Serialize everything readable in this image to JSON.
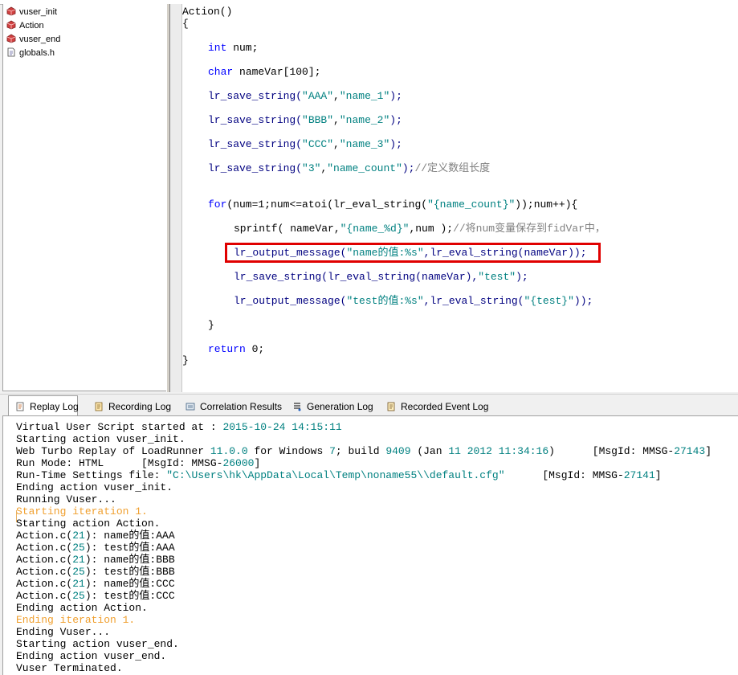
{
  "tree": {
    "items": [
      {
        "label": "vuser_init",
        "icon": "action-script-icon"
      },
      {
        "label": "Action",
        "icon": "action-script-icon"
      },
      {
        "label": "vuser_end",
        "icon": "action-script-icon"
      },
      {
        "label": "globals.h",
        "icon": "header-file-icon"
      }
    ]
  },
  "code": {
    "l1": "Action()",
    "l2": "{",
    "int_kw": "int",
    "int_rest": " num;",
    "char_kw": "char",
    "char_rest": " nameVar[",
    "char_num": "100",
    "char_end": "];",
    "s1_fn": "lr_save_string(",
    "s1_a": "\"AAA\"",
    "s1_b": ",",
    "s1_c": "\"name_1\"",
    "s1_d": ");",
    "s2_fn": "lr_save_string(",
    "s2_a": "\"BBB\"",
    "s2_b": ",",
    "s2_c": "\"name_2\"",
    "s2_d": ");",
    "s3_fn": "lr_save_string(",
    "s3_a": "\"CCC\"",
    "s3_b": ",",
    "s3_c": "\"name_3\"",
    "s3_d": ");",
    "s4_fn": "lr_save_string(",
    "s4_a": "\"3\"",
    "s4_b": ",",
    "s4_c": "\"name_count\"",
    "s4_d": ");",
    "s4_cmt": "//定义数组长度",
    "for_kw": "for",
    "for_a": "(num=",
    "for_n": "1",
    "for_b": ";num<=atoi(lr_eval_string(",
    "for_str": "\"{name_count}\"",
    "for_c": "));num++){",
    "sp_a": "sprintf( nameVar,",
    "sp_str": "\"{name_%d}\"",
    "sp_b": ",num );",
    "sp_cmt": "//将num变量保存到fidVar中，",
    "om1_a": "lr_output_message(",
    "om1_str": "\"name的值:%s\"",
    "om1_b": ",lr_eval_string(nameVar));",
    "ss_a": "lr_save_string(lr_eval_string(nameVar),",
    "ss_str": "\"test\"",
    "ss_b": ");",
    "om2_a": "lr_output_message(",
    "om2_str": "\"test的值:%s\"",
    "om2_b": ",lr_eval_string(",
    "om2_str2": "\"{test}\"",
    "om2_c": "));",
    "close_for": "}",
    "ret_kw": "return",
    "ret_rest": " 0;",
    "close_fn": "}"
  },
  "tabs": [
    {
      "label": "Replay Log",
      "icon": "replay-log-icon",
      "active": true
    },
    {
      "label": "Recording Log",
      "icon": "recording-log-icon",
      "active": false
    },
    {
      "label": "Correlation Results",
      "icon": "correlation-icon",
      "active": false
    },
    {
      "label": "Generation Log",
      "icon": "generation-log-icon",
      "active": false
    },
    {
      "label": "Recorded Event Log",
      "icon": "event-log-icon",
      "active": false
    }
  ],
  "log": {
    "l1a": "Virtual User Script started at : ",
    "l1b": "2015-10-24 14:15:11",
    "l2": "Starting action vuser_init.",
    "l3a": "Web Turbo Replay of LoadRunner ",
    "l3b": "11.0.0",
    "l3c": " for Windows ",
    "l3d": "7",
    "l3e": "; build ",
    "l3f": "9409",
    "l3g": " (Jan ",
    "l3h": "11 2012 11:34:16",
    "l3i": ")      [MsgId: MMSG-",
    "l3j": "27143",
    "l3k": "]",
    "l4a": "Run Mode: HTML      [MsgId: MMSG-",
    "l4b": "26000",
    "l4c": "]",
    "l5a": "Run-Time Settings file: ",
    "l5b": "\"C:\\Users\\hk\\AppData\\Local\\Temp\\noname55\\\\default.cfg\"",
    "l5c": "      [MsgId: MMSG-",
    "l5d": "27141",
    "l5e": "]",
    "l6": "Ending action vuser_init.",
    "l7": "Running Vuser...",
    "l8": "Starting iteration 1.",
    "l9": "Starting action Action.",
    "r1a": "Action.c(",
    "r1b": "21",
    "r1c": "): name的值:AAA",
    "r2a": "Action.c(",
    "r2b": "25",
    "r2c": "): test的值:AAA",
    "r3a": "Action.c(",
    "r3b": "21",
    "r3c": "): name的值:BBB",
    "r4a": "Action.c(",
    "r4b": "25",
    "r4c": "): test的值:BBB",
    "r5a": "Action.c(",
    "r5b": "21",
    "r5c": "): name的值:CCC",
    "r6a": "Action.c(",
    "r6b": "25",
    "r6c": "): test的值:CCC",
    "l10": "Ending action Action.",
    "l11": "Ending iteration 1.",
    "l12": "Ending Vuser...",
    "l13": "Starting action vuser_end.",
    "l14": "Ending action vuser_end.",
    "l15": "Vuser Terminated."
  }
}
